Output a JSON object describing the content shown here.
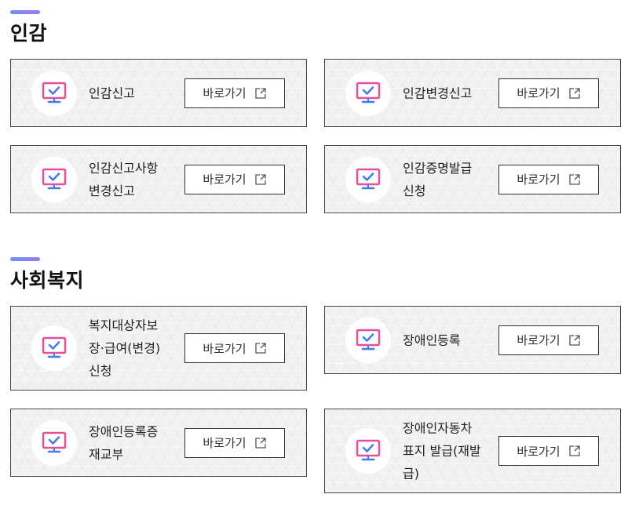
{
  "sections": [
    {
      "title": "인감",
      "cards": [
        {
          "label": "인감신고",
          "button": "바로가기"
        },
        {
          "label": "인감변경신고",
          "button": "바로가기"
        },
        {
          "label": "인감신고사항\n변경신고",
          "button": "바로가기"
        },
        {
          "label": "인감증명발급\n신청",
          "button": "바로가기"
        }
      ]
    },
    {
      "title": "사회복지",
      "cards": [
        {
          "label": "복지대상자보\n장·급여(변경)\n신청",
          "button": "바로가기"
        },
        {
          "label": "장애인등록",
          "button": "바로가기"
        },
        {
          "label": "장애인등록증\n재교부",
          "button": "바로가기"
        },
        {
          "label": "장애인자동차\n표지 발급(재발\n급)",
          "button": "바로가기"
        }
      ]
    }
  ],
  "icons": {
    "card": "monitor-check-icon",
    "button": "external-link-icon"
  },
  "colors": {
    "accent_gradient_start": "#6f8ff5",
    "accent_gradient_end": "#9b7cf0",
    "icon_pink": "#e84f9b",
    "icon_blue": "#3f7cf4"
  }
}
